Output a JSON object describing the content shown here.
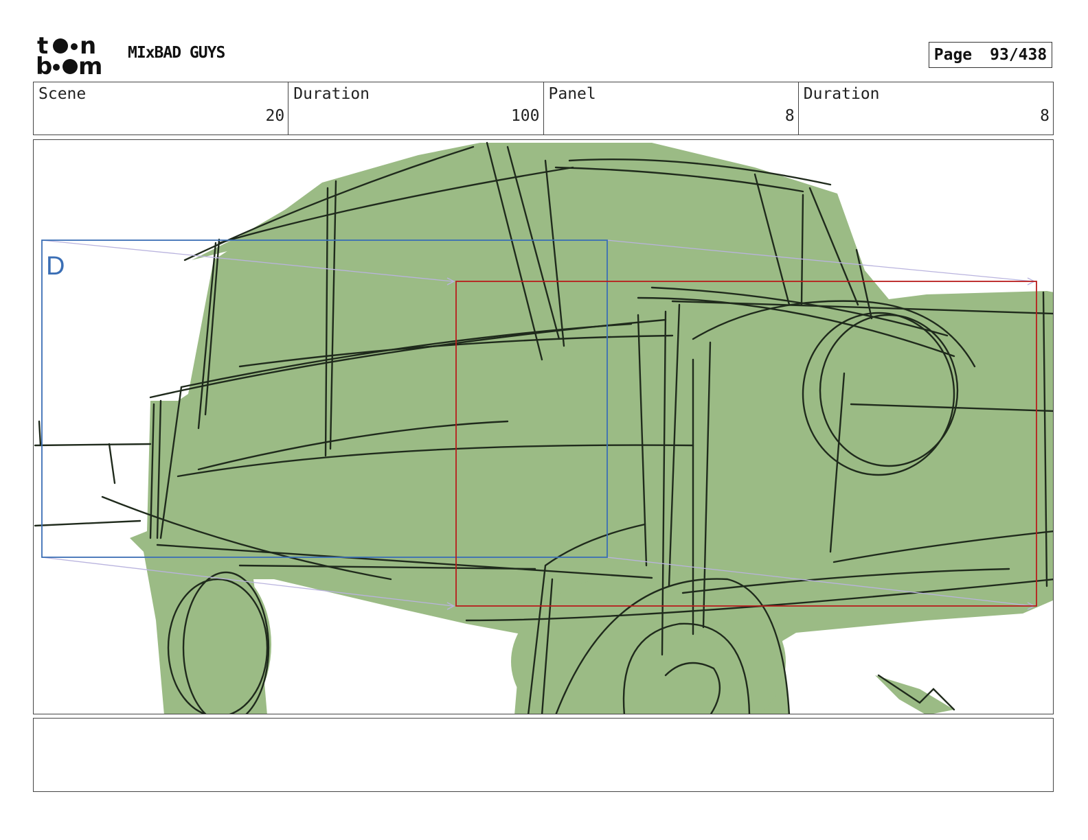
{
  "header": {
    "logo_text": "toon boom",
    "project_title": "MIxBAD GUYS",
    "page_label": "Page",
    "page_number": "93/438"
  },
  "info": {
    "scene_label": "Scene",
    "scene_value": "20",
    "scene_duration_label": "Duration",
    "scene_duration_value": "100",
    "panel_label": "Panel",
    "panel_value": "8",
    "panel_duration_label": "Duration",
    "panel_duration_value": "8"
  },
  "panel": {
    "camera_marker": "D",
    "fill_color": "#9bbb85",
    "line_color": "#1f2a1c",
    "start_frame_color": "#3a6eb5",
    "end_frame_color": "#b81c1c"
  },
  "notes": {
    "text": ""
  }
}
